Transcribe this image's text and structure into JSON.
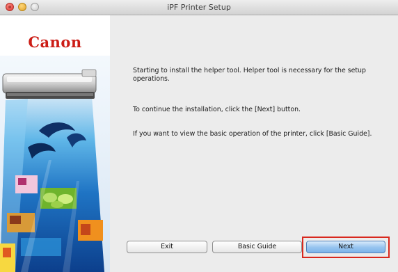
{
  "window": {
    "title": "iPF Printer Setup",
    "controls": [
      "close",
      "minimize",
      "zoom"
    ]
  },
  "banner": {
    "logo_text": "Canon"
  },
  "messages": {
    "line1": "Starting to install the helper tool. Helper tool is necessary for the setup operations.",
    "line2": "To continue the installation, click the [Next] button.",
    "line3": "If you want to view the basic operation of the printer, click [Basic Guide]."
  },
  "buttons": {
    "exit": "Exit",
    "basic_guide": "Basic Guide",
    "next": "Next"
  },
  "colors": {
    "brand_red": "#cc1d16",
    "highlight_red": "#d8281e",
    "default_button_blue": "#95c3ef"
  }
}
